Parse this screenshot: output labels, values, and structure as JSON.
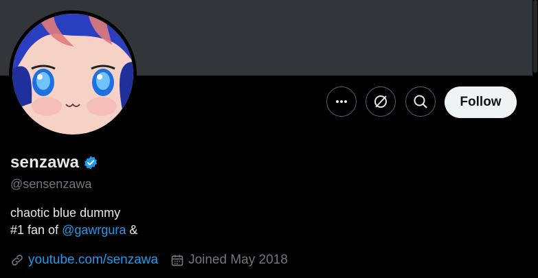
{
  "profile": {
    "display_name": "senzawa",
    "handle": "@sensenzawa",
    "bio_line1": "chaotic blue dummy",
    "bio_line2_prefix": "#1 fan of ",
    "bio_mention": "@gawrgura",
    "bio_line2_suffix": " &",
    "website": "youtube.com/senzawa",
    "joined": "Joined May 2018",
    "verified": true
  },
  "actions": {
    "follow_label": "Follow"
  },
  "icons": {
    "more": "more-horizontal-icon",
    "grok": "grok-icon",
    "search": "search-icon",
    "verified": "verified-badge-icon",
    "link": "link-icon",
    "calendar": "calendar-icon"
  },
  "colors": {
    "accent": "#1d9bf0",
    "follow_bg": "#eff3f4",
    "muted_text": "#71767b",
    "banner": "#333639"
  }
}
